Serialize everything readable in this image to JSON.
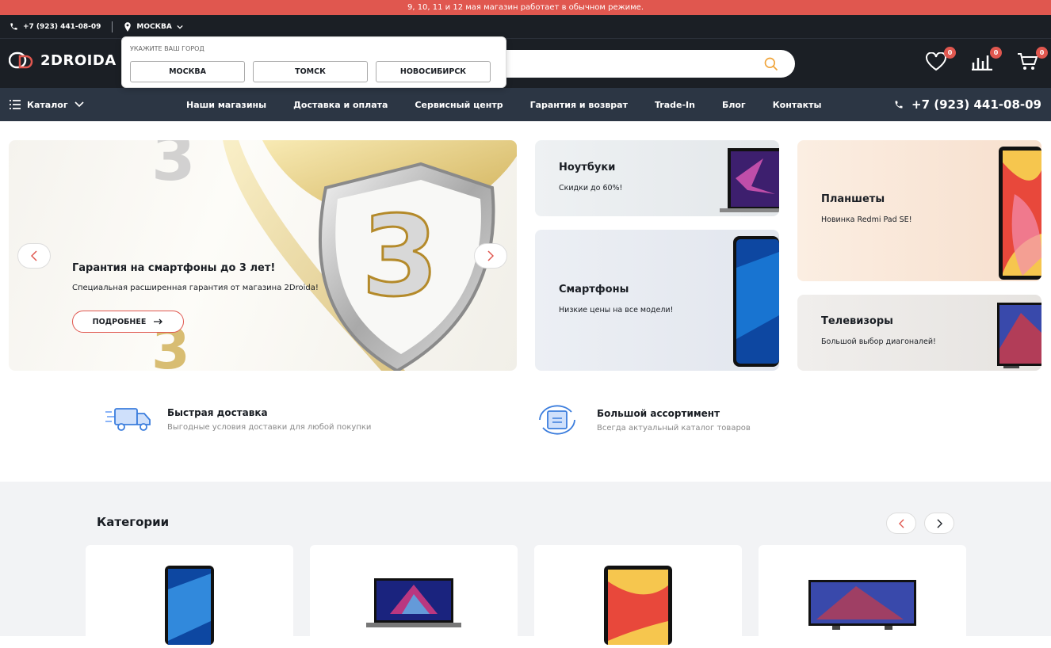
{
  "announcement": "9, 10, 11 и 12 мая магазин работает в обычном режиме.",
  "topbar": {
    "phone": "+7 (923) 441-08-09",
    "city": "МОСКВА"
  },
  "logo": {
    "text": "2DROIDA"
  },
  "city_dropdown": {
    "label": "УКАЖИТЕ ВАШ ГОРОД",
    "cities": [
      "МОСКВА",
      "ТОМСК",
      "НОВОСИБИРСК"
    ]
  },
  "header_icons": {
    "favorites_count": "0",
    "compare_count": "0",
    "cart_count": "0"
  },
  "nav": {
    "catalog": "Каталог",
    "links": [
      "Наши магазины",
      "Доставка и оплата",
      "Сервисный центр",
      "Гарантия и возврат",
      "Trade-In",
      "Блог",
      "Контакты"
    ],
    "phone": "+7 (923) 441-08-09"
  },
  "hero": {
    "title": "Гарантия на смартфоны до 3 лет!",
    "subtitle": "Специальная расширенная гарантия от магазина 2Droida!",
    "button": "ПОДРОБНЕЕ"
  },
  "promos": [
    {
      "title": "Ноутбуки",
      "subtitle": "Скидки до 60%!"
    },
    {
      "title": "Смартфоны",
      "subtitle": "Низкие цены на все модели!"
    },
    {
      "title": "Планшеты",
      "subtitle": "Новинка Redmi Pad SE!"
    },
    {
      "title": "Телевизоры",
      "subtitle": "Большой выбор диагоналей!"
    }
  ],
  "features": [
    {
      "title": "Быстрая доставка",
      "subtitle": "Выгодные условия доставки для любой покупки"
    },
    {
      "title": "Большой ассортимент",
      "subtitle": "Всегда актуальный каталог товаров"
    }
  ],
  "categories": {
    "title": "Категории"
  },
  "colors": {
    "accent": "#e0574f",
    "dark": "#1b1f25",
    "nav": "#2c3644"
  }
}
